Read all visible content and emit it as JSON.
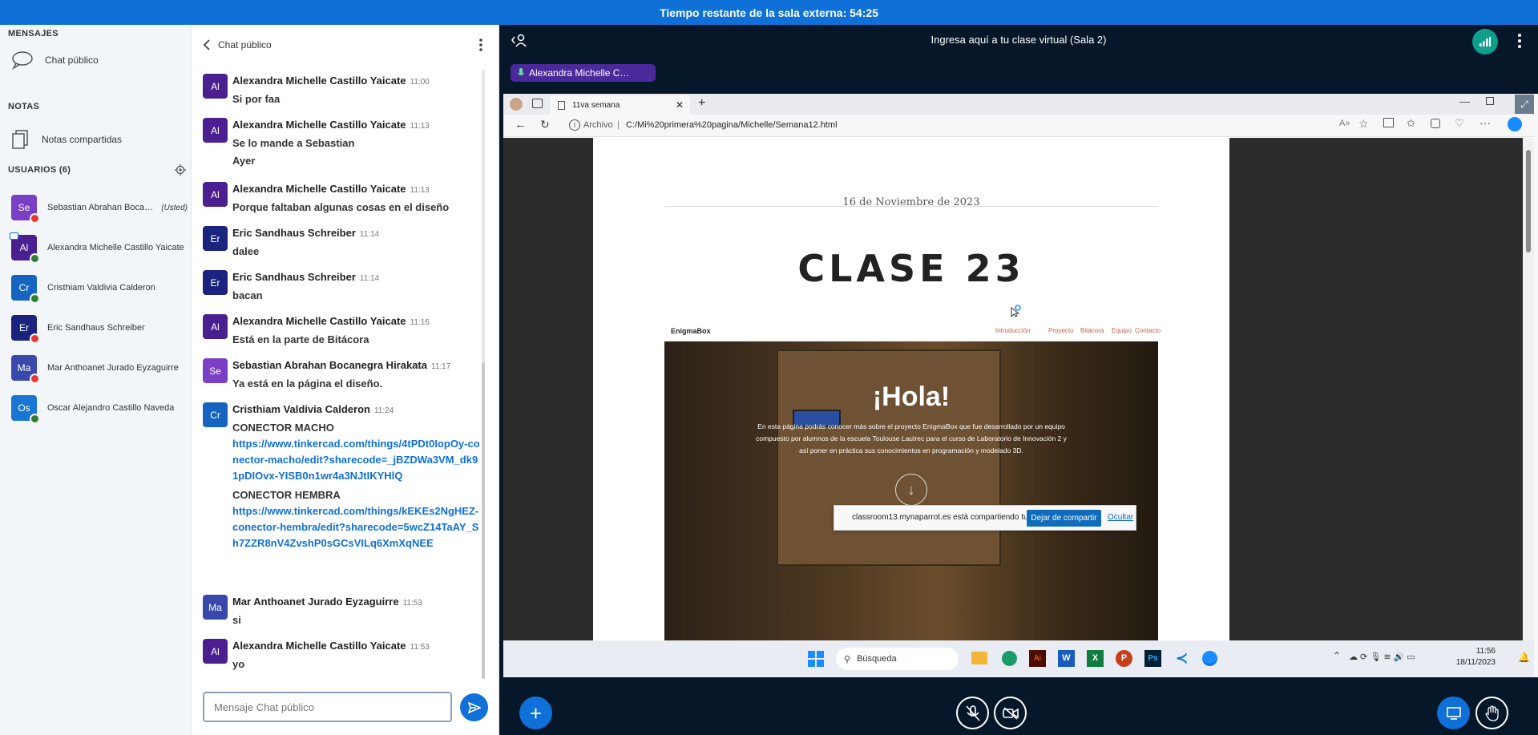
{
  "top_banner": "Tiempo restante de la sala externa: 54:25",
  "sidebar": {
    "messages_title": "MENSAJES",
    "public_chat": "Chat público",
    "notes_title": "NOTAS",
    "shared_notes": "Notas compartidas",
    "users_title": "USUARIOS (6)",
    "users": [
      {
        "initials": "Se",
        "name": "Sebastian Abrahan Bocaneg…",
        "you": "(Usted)",
        "color": "#7b3fc6",
        "status_color": "#e53935"
      },
      {
        "initials": "Al",
        "name": "Alexandra Michelle Castillo Yaicate",
        "you": "",
        "color": "#4b1f8f",
        "status_color": "#2e7d32"
      },
      {
        "initials": "Cr",
        "name": "Cristhiam Valdivia Calderon",
        "you": "",
        "color": "#1565c0",
        "status_color": "#2e7d32"
      },
      {
        "initials": "Er",
        "name": "Eric Sandhaus Schreiber",
        "you": "",
        "color": "#1a237e",
        "status_color": "#e53935"
      },
      {
        "initials": "Ma",
        "name": "Mar Anthoanet Jurado Eyzaguirre",
        "you": "",
        "color": "#3949ab",
        "status_color": "#e53935"
      },
      {
        "initials": "Os",
        "name": "Oscar Alejandro Castillo Naveda",
        "you": "",
        "color": "#1976d2",
        "status_color": "#2e7d32"
      }
    ]
  },
  "chat": {
    "title": "Chat público",
    "messages": [
      {
        "initials": "Al",
        "color": "#4b1f8f",
        "name": "Alexandra Michelle Castillo Yaicate",
        "time": "11:00",
        "lines": [
          "Si por faa"
        ]
      },
      {
        "initials": "Al",
        "color": "#4b1f8f",
        "name": "Alexandra Michelle Castillo Yaicate",
        "time": "11:13",
        "lines": [
          "Se lo mande a Sebastian",
          "Ayer"
        ]
      },
      {
        "initials": "Al",
        "color": "#4b1f8f",
        "name": "Alexandra Michelle Castillo Yaicate",
        "time": "11:13",
        "lines": [
          "Porque faltaban algunas cosas en el diseño"
        ]
      },
      {
        "initials": "Er",
        "color": "#1a237e",
        "name": "Eric Sandhaus Schreiber",
        "time": "11:14",
        "lines": [
          "dalee"
        ]
      },
      {
        "initials": "Er",
        "color": "#1a237e",
        "name": "Eric Sandhaus Schreiber",
        "time": "11:14",
        "lines": [
          "bacan"
        ]
      },
      {
        "initials": "Al",
        "color": "#4b1f8f",
        "name": "Alexandra Michelle Castillo Yaicate",
        "time": "11:16",
        "lines": [
          "Está en la parte de Bitácora"
        ]
      },
      {
        "initials": "Se",
        "color": "#7b3fc6",
        "name": "Sebastian Abrahan Bocanegra Hirakata",
        "time": "11:17",
        "lines": [
          "Ya está en la página el diseño."
        ]
      },
      {
        "initials": "Cr",
        "color": "#1565c0",
        "name": "Cristhiam Valdivia Calderon",
        "time": "11:24",
        "lines": [
          "CONECTOR MACHO"
        ]
      },
      {
        "initials": "Ma",
        "color": "#3949ab",
        "name": "Mar Anthoanet Jurado Eyzaguirre",
        "time": "11:53",
        "lines": [
          "si"
        ]
      },
      {
        "initials": "Al",
        "color": "#4b1f8f",
        "name": "Alexandra Michelle Castillo Yaicate",
        "time": "11:53",
        "lines": [
          "yo"
        ]
      }
    ],
    "link1": "https://www.tinkercad.com/things/4tPDt0IopOy-conector-macho/edit?sharecode=_jBZDWa3VM_dk91pDIOvx-YISB0n1wr4a3NJtIKYHlQ",
    "label2": "CONECTOR HEMBRA",
    "link2": "https://www.tinkercad.com/things/kEKEs2NgHEZ-conector-hembra/edit?sharecode=5wcZ14TaAY_Sh7ZZR8nV4ZvshP0sGCsVILq6XmXqNEE",
    "input_placeholder": "Mensaje Chat público"
  },
  "presentation": {
    "room_title": "Ingresa aquí a tu clase virtual (Sala 2)",
    "presenter": "Alexandra Michelle C…",
    "browser_tab": "11va semana",
    "address_label": "Archivo",
    "address_url": "C:/Mi%20primera%20pagina/Michelle/Semana12.html",
    "page_date": "16 de Noviembre de 2023",
    "page_heading": "CLASE 23",
    "site_brand": "EnigmaBox",
    "site_nav": [
      "Introducción",
      "Proyecto",
      "Bitácora",
      "Equipo",
      "Contacto"
    ],
    "hero_title": "¡Hola!",
    "hero_text_1": "En esta página podrás conocer más sobre el proyecto EnigmaBox que fue desarrollado por un equipo",
    "hero_text_2": "compuesto por alumnos de la escuela Toulouse Lautrec para el curso de Laboratorio de Innovación 2 y",
    "hero_text_3": "así poner en práctica sus conocimientos en programación y modelado 3D.",
    "share_notice": "classroom13.mynaparrot.es está compartiendo tu pantalla.",
    "stop_share": "Dejar de compartir",
    "hide": "Ocultar",
    "taskbar_search": "Búsqueda",
    "clock_time": "11:56",
    "clock_date": "18/11/2023"
  },
  "colors": {
    "accent": "#0f70d7",
    "dark_bg": "#06172a"
  }
}
